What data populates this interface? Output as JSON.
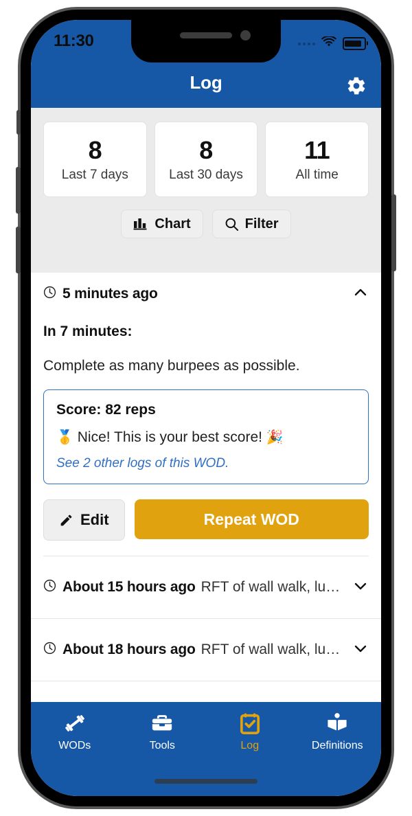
{
  "status_bar": {
    "time": "11:30",
    "signal_icon": "signal-dots-icon",
    "wifi_icon": "wifi-icon",
    "battery_icon": "battery-full-icon"
  },
  "app_bar": {
    "title": "Log",
    "settings_icon": "gear-icon"
  },
  "stats": {
    "cards": [
      {
        "value": "8",
        "label": "Last 7 days"
      },
      {
        "value": "8",
        "label": "Last 30 days"
      },
      {
        "value": "11",
        "label": "All time"
      }
    ],
    "chart_button": {
      "label": "Chart",
      "icon": "bar-chart-icon"
    },
    "filter_button": {
      "label": "Filter",
      "icon": "search-icon"
    }
  },
  "log_entries": [
    {
      "expanded": true,
      "clock_icon": "clock-icon",
      "timestamp": "5 minutes ago",
      "chevron_icon": "chevron-up-icon",
      "wod_title": "In 7 minutes:",
      "wod_description": "Complete as many burpees as possible.",
      "score": "Score: 82 reps",
      "praise_prefix_emoji": "🥇",
      "praise": "Nice! This is your best score!",
      "praise_suffix_emoji": "🎉",
      "other_logs_link": "See 2 other logs of this WOD.",
      "edit_label": "Edit",
      "edit_icon": "pencil-icon",
      "repeat_label": "Repeat WOD"
    },
    {
      "expanded": false,
      "clock_icon": "clock-icon",
      "timestamp": "About 15 hours ago",
      "preview": "RFT of wall walk, lu…",
      "chevron_icon": "chevron-down-icon"
    },
    {
      "expanded": false,
      "clock_icon": "clock-icon",
      "timestamp": "About 18 hours ago",
      "preview": "RFT of wall walk, lu…",
      "chevron_icon": "chevron-down-icon"
    }
  ],
  "tab_bar": {
    "tabs": [
      {
        "label": "WODs",
        "icon": "dumbbell-icon",
        "active": false
      },
      {
        "label": "Tools",
        "icon": "toolbox-icon",
        "active": false
      },
      {
        "label": "Log",
        "icon": "calendar-check-icon",
        "active": true
      },
      {
        "label": "Definitions",
        "icon": "open-book-icon",
        "active": false
      }
    ]
  },
  "colors": {
    "brand_blue": "#1658A6",
    "accent_gold": "#E0A30F",
    "link_blue": "#2F6FC4",
    "stats_bg": "#EBEBEB"
  }
}
